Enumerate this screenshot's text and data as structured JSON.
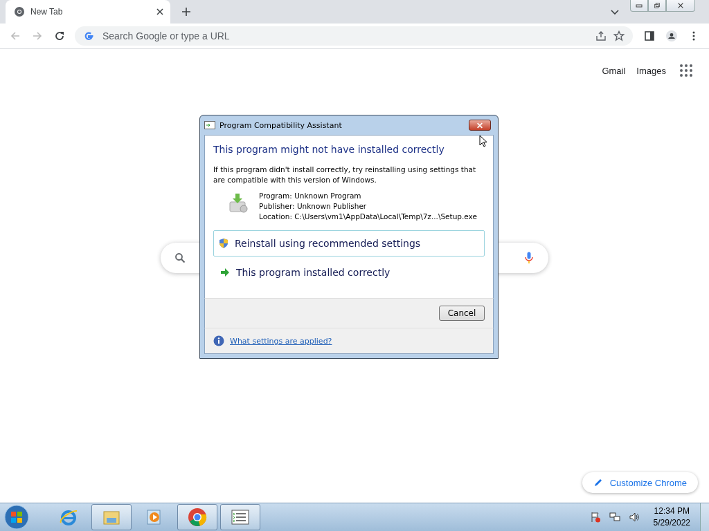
{
  "browser": {
    "tabs": [
      {
        "title": "New Tab",
        "selected": true
      }
    ],
    "address_bar": {
      "placeholder": "Search Google or type a URL"
    },
    "top_links": [
      "Gmail",
      "Images"
    ],
    "customize_button": "Customize Chrome"
  },
  "dialog": {
    "title": "Program Compatibility Assistant",
    "heading": "This program might not have installed correctly",
    "message": "If this program didn't install correctly, try reinstalling using settings that are compatible with this version of Windows.",
    "details": [
      "Program: Unknown Program",
      "Publisher: Unknown Publisher",
      "Location: C:\\Users\\vm1\\AppData\\Local\\Temp\\7z...\\Setup.exe"
    ],
    "options": [
      {
        "label": "Reinstall using recommended settings",
        "kind": "shield",
        "selected": true
      },
      {
        "label": "This program installed correctly",
        "kind": "arrow",
        "selected": false
      }
    ],
    "cancel_button": "Cancel",
    "help_link": "What settings are applied?"
  },
  "taskbar": {
    "apps": [
      {
        "kind": "ie",
        "running": false
      },
      {
        "kind": "explorer",
        "running": true
      },
      {
        "kind": "media",
        "running": false
      },
      {
        "kind": "chrome",
        "running": true
      },
      {
        "kind": "tasks",
        "running": true
      }
    ],
    "time": "12:34 PM",
    "date": "5/29/2022"
  }
}
